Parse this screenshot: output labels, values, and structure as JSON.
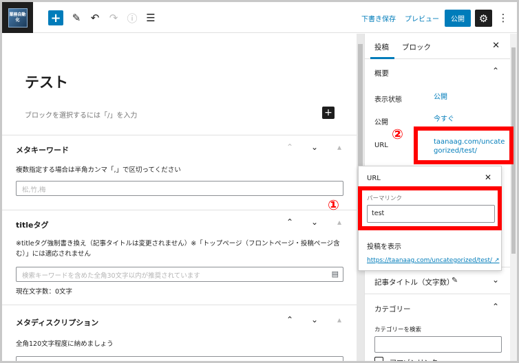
{
  "toolbar": {
    "logo_text": "業務自動化",
    "draft_label": "下書き保存",
    "preview_label": "プレビュー",
    "publish_label": "公開"
  },
  "editor": {
    "post_title": "テスト",
    "block_hint": "ブロックを選択するには「/」を入力"
  },
  "metaboxes": {
    "keywords": {
      "title": "メタキーワード",
      "description": "複数指定する場合は半角カンマ「,」で区切ってください",
      "placeholder": "松,竹,梅"
    },
    "title_tag": {
      "title": "titleタグ",
      "description": "※titleタグ強制書き換え（記事タイトルは変更されません）※「トップページ（フロントページ・投稿ページ含む）」には適応されません",
      "placeholder": "検索キーワードを含めた全角30文字以内が推奨されています",
      "count": "現在文字数：0文字"
    },
    "meta_description": {
      "title": "メタディスクリプション",
      "description": "全角120文字程度に納めましょう"
    }
  },
  "sidebar": {
    "tab_post": "投稿",
    "tab_block": "ブロック",
    "summary_title": "概要",
    "visibility_label": "表示状態",
    "visibility_value": "公開",
    "publish_label": "公開",
    "publish_value": "今すぐ",
    "url_label": "URL",
    "url_value_line1": "taanaag.com/uncate",
    "url_value_line2": "gorized/test/",
    "article_title_label": "記事タイトル（文字数）",
    "category_title": "カテゴリー",
    "category_search_label": "カテゴリーを検索",
    "category_item": "アマゾンリンク"
  },
  "popover": {
    "title": "URL",
    "permalink_label": "パーマリンク",
    "permalink_value": "test",
    "view_post_label": "投稿を表示",
    "view_post_link": "https://taanaag.com/uncategorized/test/"
  },
  "annotations": {
    "marker_1": "①",
    "marker_2": "②",
    "color": "#ff0000"
  },
  "colors": {
    "accent": "#007cba",
    "dark": "#1e1e1e"
  },
  "icons": [
    "plus-icon",
    "pencil-icon",
    "undo-icon",
    "redo-icon",
    "info-icon",
    "list-view-icon",
    "gear-icon",
    "more-vertical-icon",
    "close-icon",
    "chevron-up-icon",
    "chevron-down-icon",
    "external-link-icon"
  ]
}
